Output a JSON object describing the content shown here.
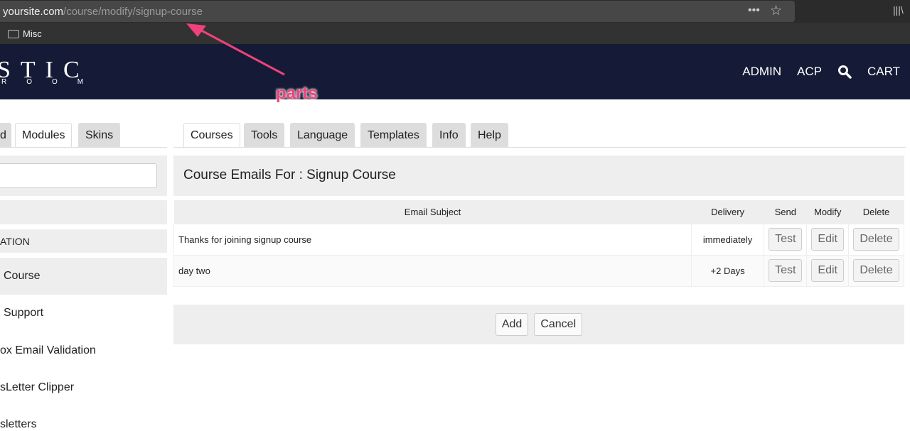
{
  "browser": {
    "url_domain": "yoursite.com",
    "url_path": "/course/modify/signup-course",
    "bookmark": "Misc"
  },
  "header": {
    "logo_top": "STIC",
    "logo_bottom": "ROOM",
    "nav": [
      "ADMIN",
      "ACP",
      "CART"
    ]
  },
  "annotation": "parts",
  "left_tabs": [
    "d",
    "Modules",
    "Skins"
  ],
  "main_tabs": [
    "Courses",
    "Tools",
    "Language",
    "Templates",
    "Info",
    "Help"
  ],
  "sidebar": {
    "section": "ATION",
    "items": [
      "Course",
      "Support",
      "ox Email Validation",
      "sLetter Clipper",
      "sletters"
    ]
  },
  "panel_title": "Course Emails For : Signup Course",
  "table": {
    "headers": [
      "Email Subject",
      "Delivery",
      "Send",
      "Modify",
      "Delete"
    ],
    "rows": [
      {
        "subject": "Thanks for joining signup course",
        "delivery": "immediately",
        "send": "Test",
        "modify": "Edit",
        "delete": "Delete"
      },
      {
        "subject": "day two",
        "delivery": "+2 Days",
        "send": "Test",
        "modify": "Edit",
        "delete": "Delete"
      }
    ]
  },
  "buttons": {
    "add": "Add",
    "cancel": "Cancel"
  }
}
